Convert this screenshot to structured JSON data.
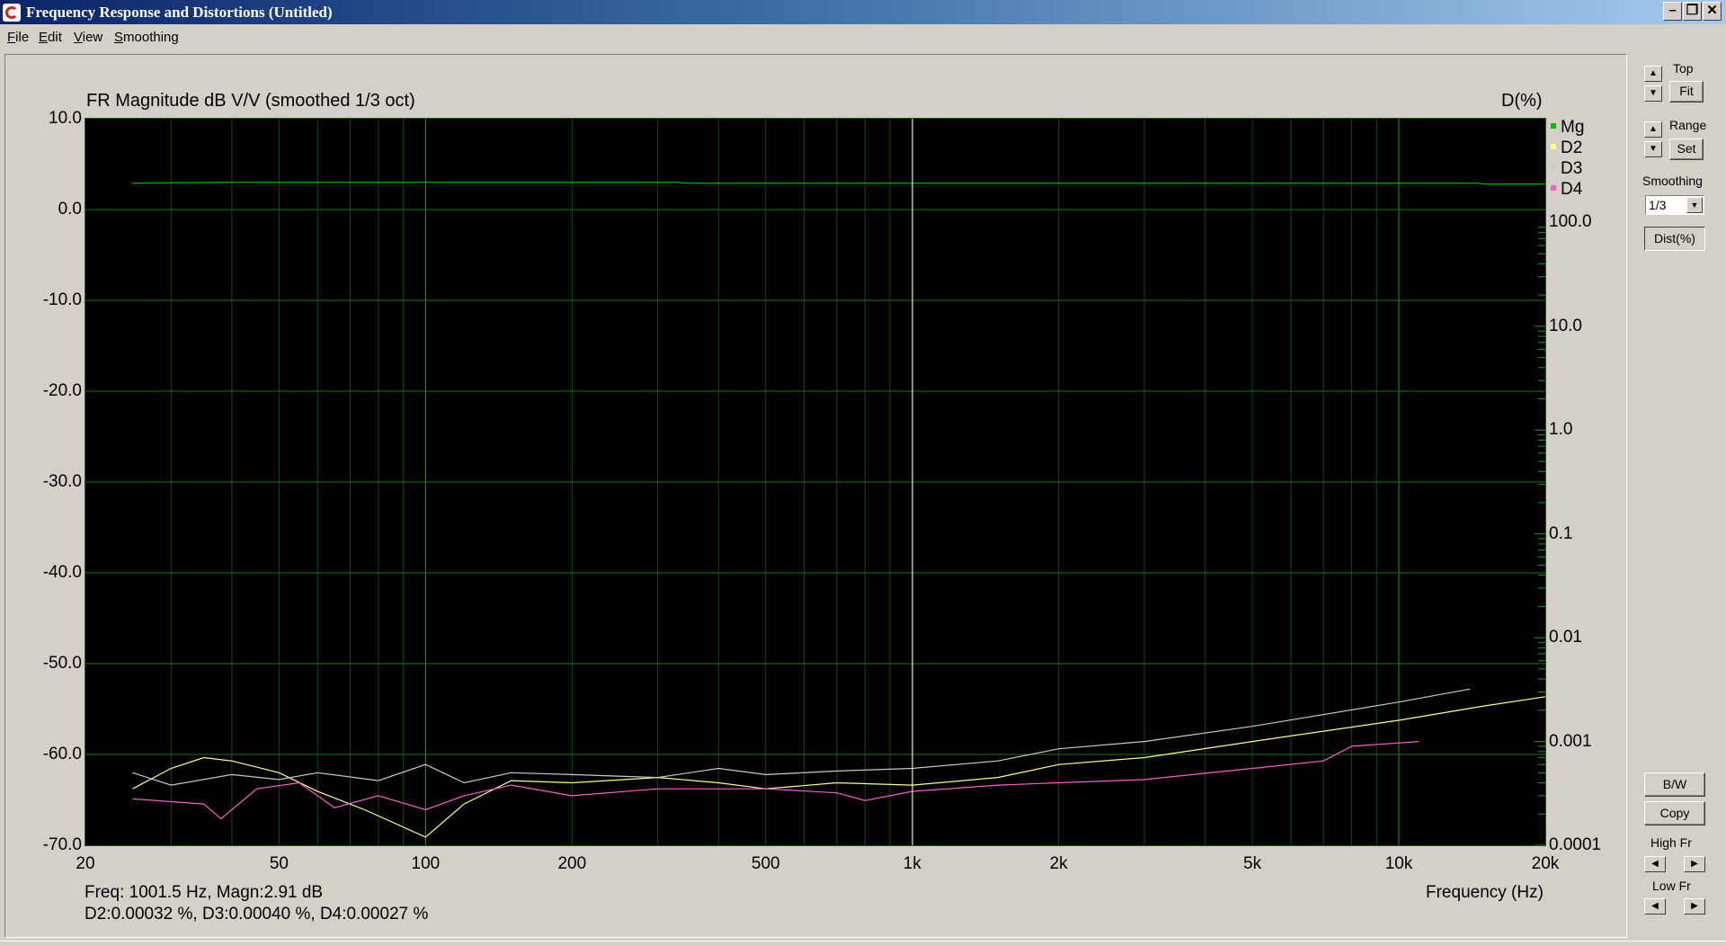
{
  "window": {
    "title": "Frequency Response and Distortions (Untitled)"
  },
  "menu": [
    {
      "label": "File",
      "hot": "F",
      "rest": "ile"
    },
    {
      "label": "Edit",
      "hot": "E",
      "rest": "dit"
    },
    {
      "label": "View",
      "hot": "V",
      "rest": "iew"
    },
    {
      "label": "Smoothing",
      "hot": "S",
      "rest": "moothing"
    }
  ],
  "chart": {
    "title": "FR Magnitude dB V/V (smoothed 1/3 oct)",
    "right_axis_title": "D(%)",
    "x_axis_title": "Frequency (Hz)"
  },
  "chart_data": {
    "type": "line",
    "x_scale": "log",
    "xlim": [
      20,
      20000
    ],
    "ylim_left": [
      -70,
      10
    ],
    "ylim_right_log": [
      0.0001,
      1000
    ],
    "x_ticks": [
      "20",
      "50",
      "100",
      "200",
      "500",
      "1k",
      "2k",
      "5k",
      "10k",
      "20k"
    ],
    "y_ticks_left": [
      "10.0",
      "0.0",
      "-10.0",
      "-20.0",
      "-30.0",
      "-40.0",
      "-50.0",
      "-60.0",
      "-70.0"
    ],
    "y_ticks_right": [
      "100.0",
      "10.0",
      "1.0",
      "0.1",
      "0.01",
      "0.001",
      "0.0001"
    ],
    "cursor_x": 1001.5,
    "grid": true,
    "legend_position": "right",
    "series": [
      {
        "name": "Mg",
        "axis": "left_db",
        "color": "#00c000",
        "points": [
          [
            25,
            2.9
          ],
          [
            40,
            3.0
          ],
          [
            100,
            3.0
          ],
          [
            330,
            3.0
          ],
          [
            340,
            2.9
          ],
          [
            1000,
            2.9
          ],
          [
            14500,
            2.9
          ],
          [
            15000,
            2.8
          ],
          [
            20000,
            2.8
          ]
        ]
      },
      {
        "name": "D2",
        "axis": "right_pct",
        "color": "#ffff80",
        "points": [
          [
            25,
            0.00035
          ],
          [
            30,
            0.00055
          ],
          [
            35,
            0.0007
          ],
          [
            40,
            0.00065
          ],
          [
            50,
            0.0005
          ],
          [
            60,
            0.00033
          ],
          [
            75,
            0.00022
          ],
          [
            100,
            0.00012
          ],
          [
            120,
            0.00025
          ],
          [
            150,
            0.00042
          ],
          [
            200,
            0.0004
          ],
          [
            300,
            0.00045
          ],
          [
            400,
            0.0004
          ],
          [
            500,
            0.00035
          ],
          [
            700,
            0.0004
          ],
          [
            1000,
            0.00038
          ],
          [
            1500,
            0.00045
          ],
          [
            2000,
            0.0006
          ],
          [
            3000,
            0.0007
          ],
          [
            5000,
            0.001
          ],
          [
            10000,
            0.0016
          ],
          [
            15000,
            0.0022
          ],
          [
            20000,
            0.0027
          ]
        ]
      },
      {
        "name": "D3",
        "axis": "right_pct",
        "color": "#c8c8c8",
        "points": [
          [
            25,
            0.0005
          ],
          [
            30,
            0.00038
          ],
          [
            40,
            0.00048
          ],
          [
            50,
            0.00043
          ],
          [
            60,
            0.0005
          ],
          [
            80,
            0.00042
          ],
          [
            100,
            0.0006
          ],
          [
            120,
            0.0004
          ],
          [
            150,
            0.0005
          ],
          [
            200,
            0.00048
          ],
          [
            300,
            0.00045
          ],
          [
            400,
            0.00055
          ],
          [
            500,
            0.00048
          ],
          [
            700,
            0.00052
          ],
          [
            1000,
            0.00055
          ],
          [
            1500,
            0.00065
          ],
          [
            2000,
            0.00085
          ],
          [
            3000,
            0.001
          ],
          [
            5000,
            0.0014
          ],
          [
            10000,
            0.0024
          ],
          [
            14000,
            0.0032
          ]
        ]
      },
      {
        "name": "D4",
        "axis": "right_pct",
        "color": "#ff5cc8",
        "points": [
          [
            25,
            0.00028
          ],
          [
            35,
            0.00025
          ],
          [
            38,
            0.00018
          ],
          [
            45,
            0.00035
          ],
          [
            55,
            0.0004
          ],
          [
            65,
            0.00023
          ],
          [
            80,
            0.0003
          ],
          [
            100,
            0.00022
          ],
          [
            120,
            0.0003
          ],
          [
            150,
            0.00038
          ],
          [
            200,
            0.0003
          ],
          [
            300,
            0.00035
          ],
          [
            500,
            0.00035
          ],
          [
            700,
            0.00032
          ],
          [
            800,
            0.00027
          ],
          [
            1000,
            0.00033
          ],
          [
            1500,
            0.00038
          ],
          [
            2000,
            0.0004
          ],
          [
            3000,
            0.00043
          ],
          [
            5000,
            0.00055
          ],
          [
            7000,
            0.00065
          ],
          [
            8000,
            0.0009
          ],
          [
            11000,
            0.001
          ]
        ]
      }
    ]
  },
  "readout": {
    "line1": "Freq: 1001.5 Hz, Magn:2.91 dB",
    "line2": "D2:0.00032 %, D3:0.00040 %, D4:0.00027 %"
  },
  "sidebar": {
    "top_label": "Top",
    "fit_button": "Fit",
    "range_label": "Range",
    "set_button": "Set",
    "smoothing_label": "Smoothing",
    "smoothing_value": "1/3",
    "dist_button": "Dist(%)",
    "bw_button": "B/W",
    "copy_button": "Copy",
    "high_fr_label": "High Fr",
    "low_fr_label": "Low Fr"
  },
  "icons": {
    "minimize": "minimize-icon",
    "maximize": "maximize-icon",
    "close": "close-icon",
    "spin_up": "up-arrow-icon",
    "spin_down": "down-arrow-icon",
    "spin_left": "left-arrow-icon",
    "spin_right": "right-arrow-icon"
  }
}
